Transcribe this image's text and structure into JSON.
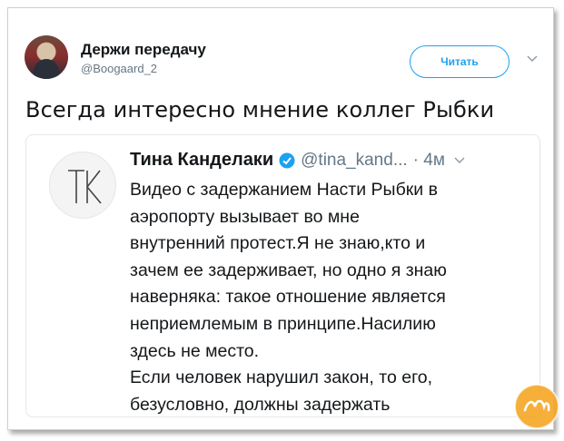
{
  "tweet": {
    "author_name": "Держи передачу",
    "author_handle": "@Boogaard_2",
    "follow_label": "Читать",
    "text": "Всегда интересно мнение коллег Рыбки"
  },
  "quoted": {
    "avatar_letters": "TK",
    "author_name": "Тина Канделаки",
    "author_handle": "@tina_kand...",
    "time": "· 4м",
    "lines": [
      "Видео с задержанием Насти Рыбки в",
      "аэропорту вызывает во мне",
      "внутренний протест.Я не знаю,кто и",
      "зачем ее задерживает, но одно я знаю",
      "наверняка: такое отношение является",
      "неприемлемым в принципе.Насилию",
      "здесь не место.",
      "Если человек нарушил закон, то его,",
      "безусловно, должны задержать"
    ]
  },
  "watermark": {
    "text": "Yaplakal"
  },
  "colors": {
    "accent": "#1da1f2",
    "secondary_text": "#657786",
    "border": "#e1e8ed",
    "watermark": "#f5a623"
  },
  "icons": {
    "verified": "verified-badge-icon",
    "caret": "chevron-down-icon"
  }
}
